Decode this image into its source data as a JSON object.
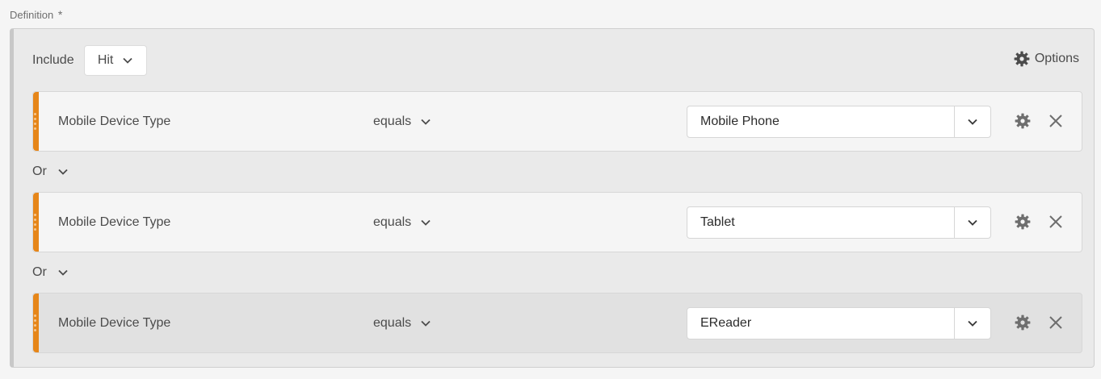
{
  "definition": {
    "label": "Definition",
    "required_marker": "*"
  },
  "container": {
    "include_label": "Include",
    "scope": "Hit",
    "options_label": "Options"
  },
  "rules": [
    {
      "dimension": "Mobile Device Type",
      "operator": "equals",
      "value": "Mobile Phone"
    },
    {
      "dimension": "Mobile Device Type",
      "operator": "equals",
      "value": "Tablet"
    },
    {
      "dimension": "Mobile Device Type",
      "operator": "equals",
      "value": "EReader"
    }
  ],
  "connectors": [
    "Or",
    "Or"
  ],
  "icons": {
    "chevron": "chevron-down-icon",
    "gear": "gear-icon",
    "close": "close-icon",
    "drag": "drag-handle-icon"
  },
  "colors": {
    "accent": "#e68619",
    "background": "#f5f5f5",
    "container": "#eaeaea"
  }
}
